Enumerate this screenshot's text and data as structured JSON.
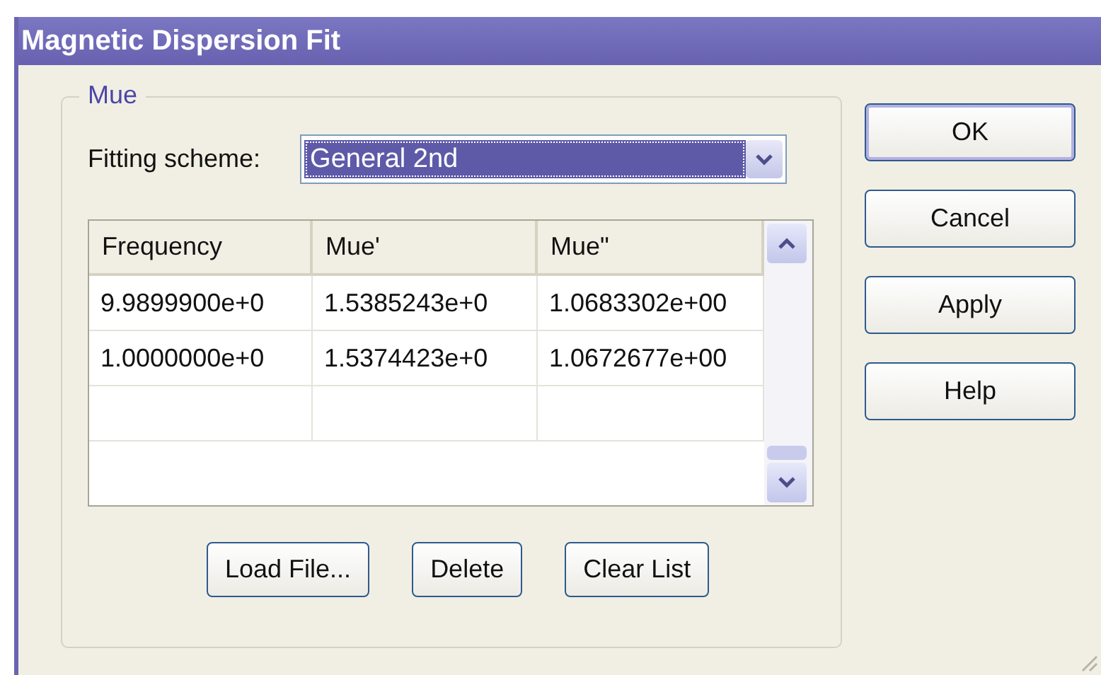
{
  "window": {
    "title": "Magnetic Dispersion Fit"
  },
  "group": {
    "title": "Mue",
    "fitting_scheme": {
      "label": "Fitting scheme:",
      "value": "General 2nd",
      "focused": true
    },
    "table": {
      "columns": [
        "Frequency",
        "Mue'",
        "Mue\""
      ],
      "rows": [
        [
          "9.9899900e+0",
          "1.5385243e+0",
          "1.0683302e+00"
        ],
        [
          "1.0000000e+0",
          "1.5374423e+0",
          "1.0672677e+00"
        ]
      ]
    },
    "buttons": [
      {
        "label": "Load File..."
      },
      {
        "label": "Delete"
      },
      {
        "label": "Clear List"
      }
    ]
  },
  "side_buttons": [
    {
      "label": "OK",
      "default": true
    },
    {
      "label": "Cancel",
      "default": false
    },
    {
      "label": "Apply",
      "default": false
    },
    {
      "label": "Help",
      "default": false
    }
  ]
}
